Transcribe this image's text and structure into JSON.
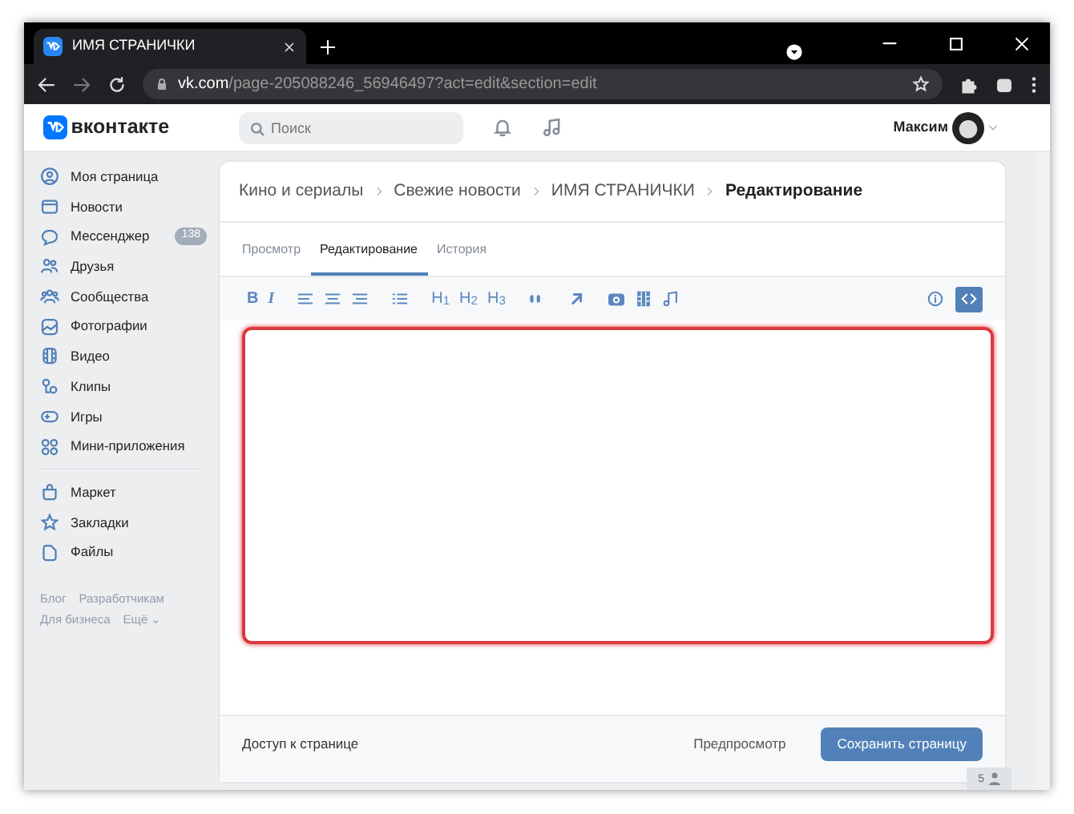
{
  "browser": {
    "tab": {
      "title": "ИМЯ СТРАНИЧКИ"
    },
    "url": {
      "host": "vk.com",
      "path": "/page-205088246_56946497?act=edit&section=edit"
    }
  },
  "header": {
    "logo": "вконтакте",
    "search": {
      "placeholder": "Поиск"
    },
    "user": "Максим"
  },
  "sidebar": {
    "sections": [
      {
        "items": [
          {
            "kind": "user",
            "label": "Моя страница"
          },
          {
            "kind": "news",
            "label": "Новости"
          },
          {
            "kind": "chat",
            "label": "Мессенджер",
            "badge": "138"
          },
          {
            "kind": "friends",
            "label": "Друзья"
          },
          {
            "kind": "groups",
            "label": "Сообщества"
          },
          {
            "kind": "photo",
            "label": "Фотографии"
          },
          {
            "kind": "video",
            "label": "Видео"
          },
          {
            "kind": "clips",
            "label": "Клипы"
          },
          {
            "kind": "games",
            "label": "Игры"
          },
          {
            "kind": "apps",
            "label": "Мини-приложения"
          }
        ]
      },
      {
        "items": [
          {
            "kind": "market",
            "label": "Маркет"
          },
          {
            "kind": "star",
            "label": "Закладки"
          },
          {
            "kind": "file",
            "label": "Файлы"
          }
        ]
      }
    ],
    "footer_links": [
      "Блог",
      "Разработчикам",
      "Для бизнеса",
      "Ещё ⌄"
    ]
  },
  "breadcrumbs": [
    "Кино и сериалы",
    "Свежие новости",
    "ИМЯ СТРАНИЧКИ",
    "Редактирование"
  ],
  "tabs": [
    {
      "label": "Просмотр",
      "selected": false
    },
    {
      "label": "Редактирование",
      "selected": true
    },
    {
      "label": "История",
      "selected": false
    }
  ],
  "toolbar": [
    [
      {
        "kind": "bold",
        "label": "B"
      },
      {
        "kind": "italic",
        "label": "I"
      }
    ],
    [
      {
        "kind": "align-left"
      },
      {
        "kind": "align-center"
      },
      {
        "kind": "align-right"
      }
    ],
    [
      {
        "kind": "list"
      }
    ],
    [
      {
        "kind": "heading",
        "label": "H$_{1}$"
      },
      {
        "kind": "heading",
        "label": "H$_{2}$"
      },
      {
        "kind": "heading",
        "label": "H$_{3}$"
      }
    ],
    [
      {
        "kind": "quote"
      }
    ],
    [
      {
        "kind": "link"
      }
    ],
    [
      {
        "kind": "camera"
      },
      {
        "kind": "film"
      },
      {
        "kind": "music"
      }
    ]
  ],
  "toolbar_right": [
    {
      "kind": "info",
      "selected": false
    },
    {
      "kind": "code",
      "selected": true
    }
  ],
  "footer": {
    "access_link": "Доступ к странице",
    "preview_button": "Предпросмотр",
    "save_button": "Сохранить страницу"
  },
  "online_counter": "5"
}
